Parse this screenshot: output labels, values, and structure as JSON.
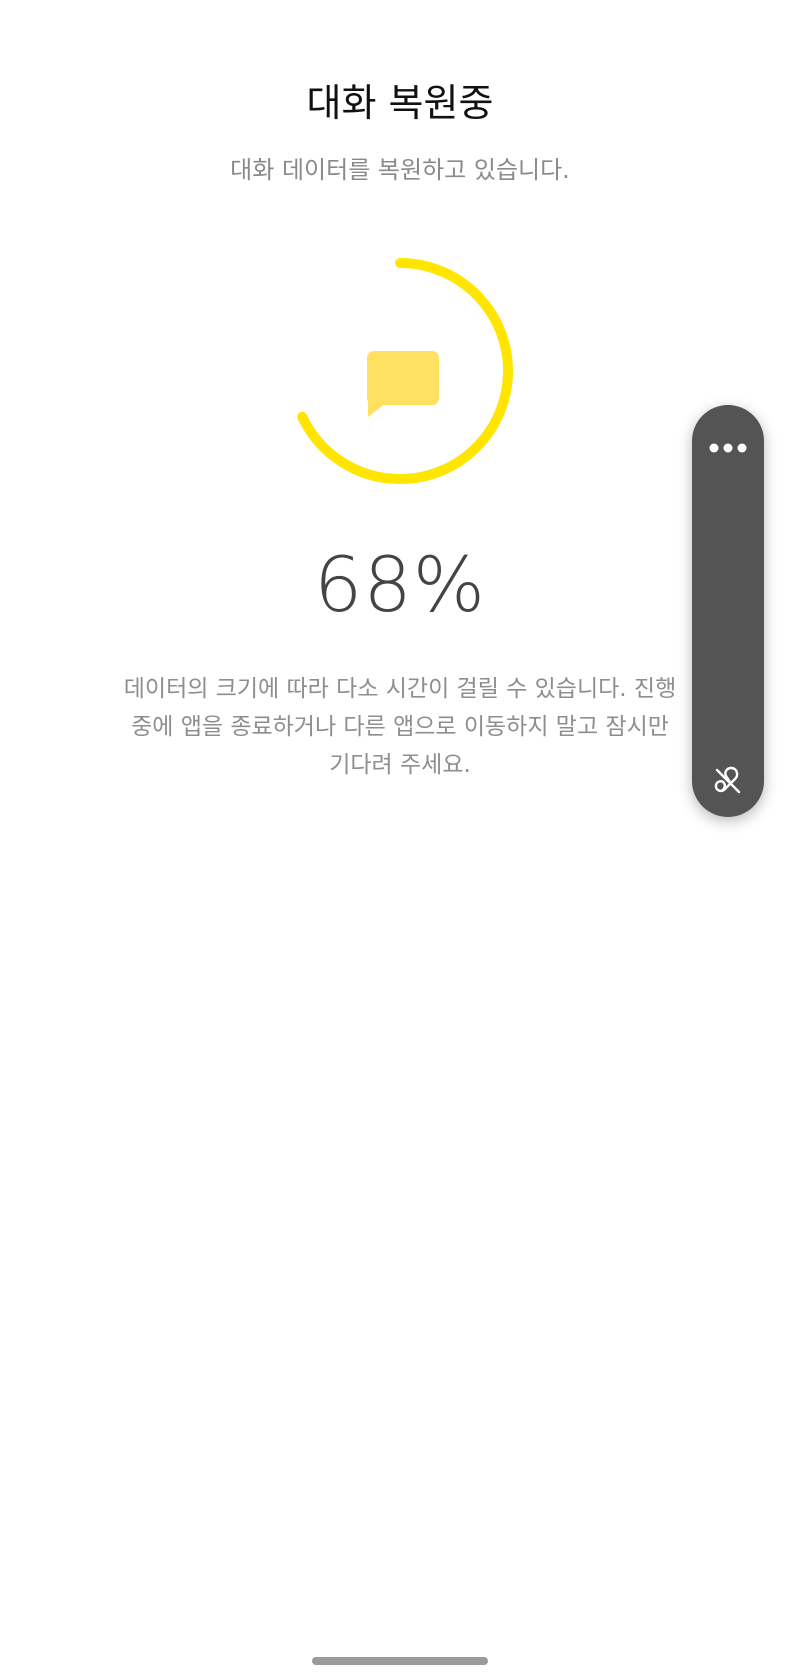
{
  "header": {
    "title": "대화 복원중",
    "subtitle": "대화 데이터를 복원하고 있습니다."
  },
  "progress": {
    "value": 68,
    "label": "68%",
    "ring_color": "#FFE500",
    "icon_color": "#FFE061",
    "icon": "chat-bubble-icon"
  },
  "notice": {
    "line1": "데이터의 크기에 따라 다소 시간이 걸릴 수 있습니다. 진행",
    "line2": "중에 앱을 종료하거나 다른 앱으로 이동하지 말고 잠시만",
    "line3": "기다려 주세요."
  },
  "floating_panel": {
    "top_icon": "more-dots-icon",
    "bottom_icon": "sound-off-icon"
  }
}
